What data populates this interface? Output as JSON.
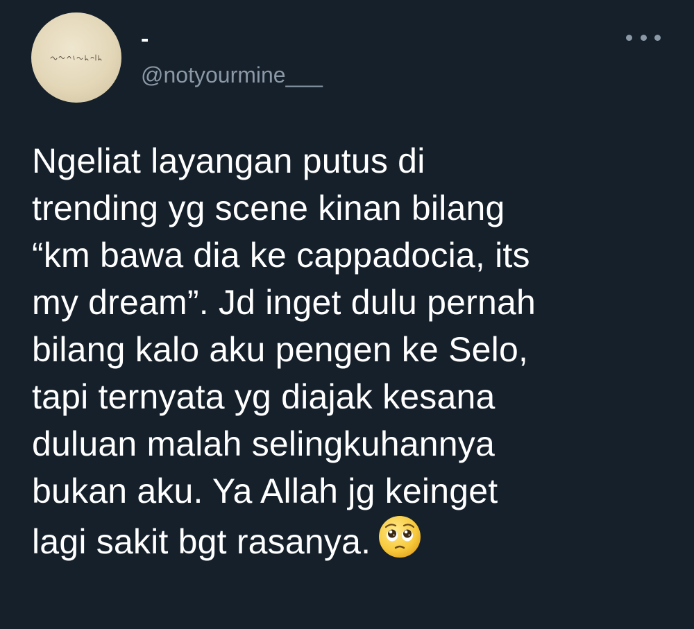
{
  "author": {
    "display_name": "-",
    "handle": "@notyourmine___",
    "avatar_text": "mau ke bali"
  },
  "tweet": {
    "text": "Ngeliat  layangan putus di\ntrending yg scene kinan bilang\n“km bawa dia ke cappadocia, its\nmy dream”. Jd inget dulu pernah\nbilang kalo aku pengen ke Selo,\ntapi ternyata yg diajak kesana\nduluan malah selingkuhannya\nbukan aku. Ya Allah jg keinget\nlagi sakit bgt rasanya.",
    "emoji": "pleading-face-emoji"
  },
  "menu": {
    "icon": "more-horizontal-icon"
  },
  "colors": {
    "background": "#15202b",
    "text": "#ffffff",
    "secondary": "#8b98a5",
    "avatar": "#e3d7b8"
  }
}
